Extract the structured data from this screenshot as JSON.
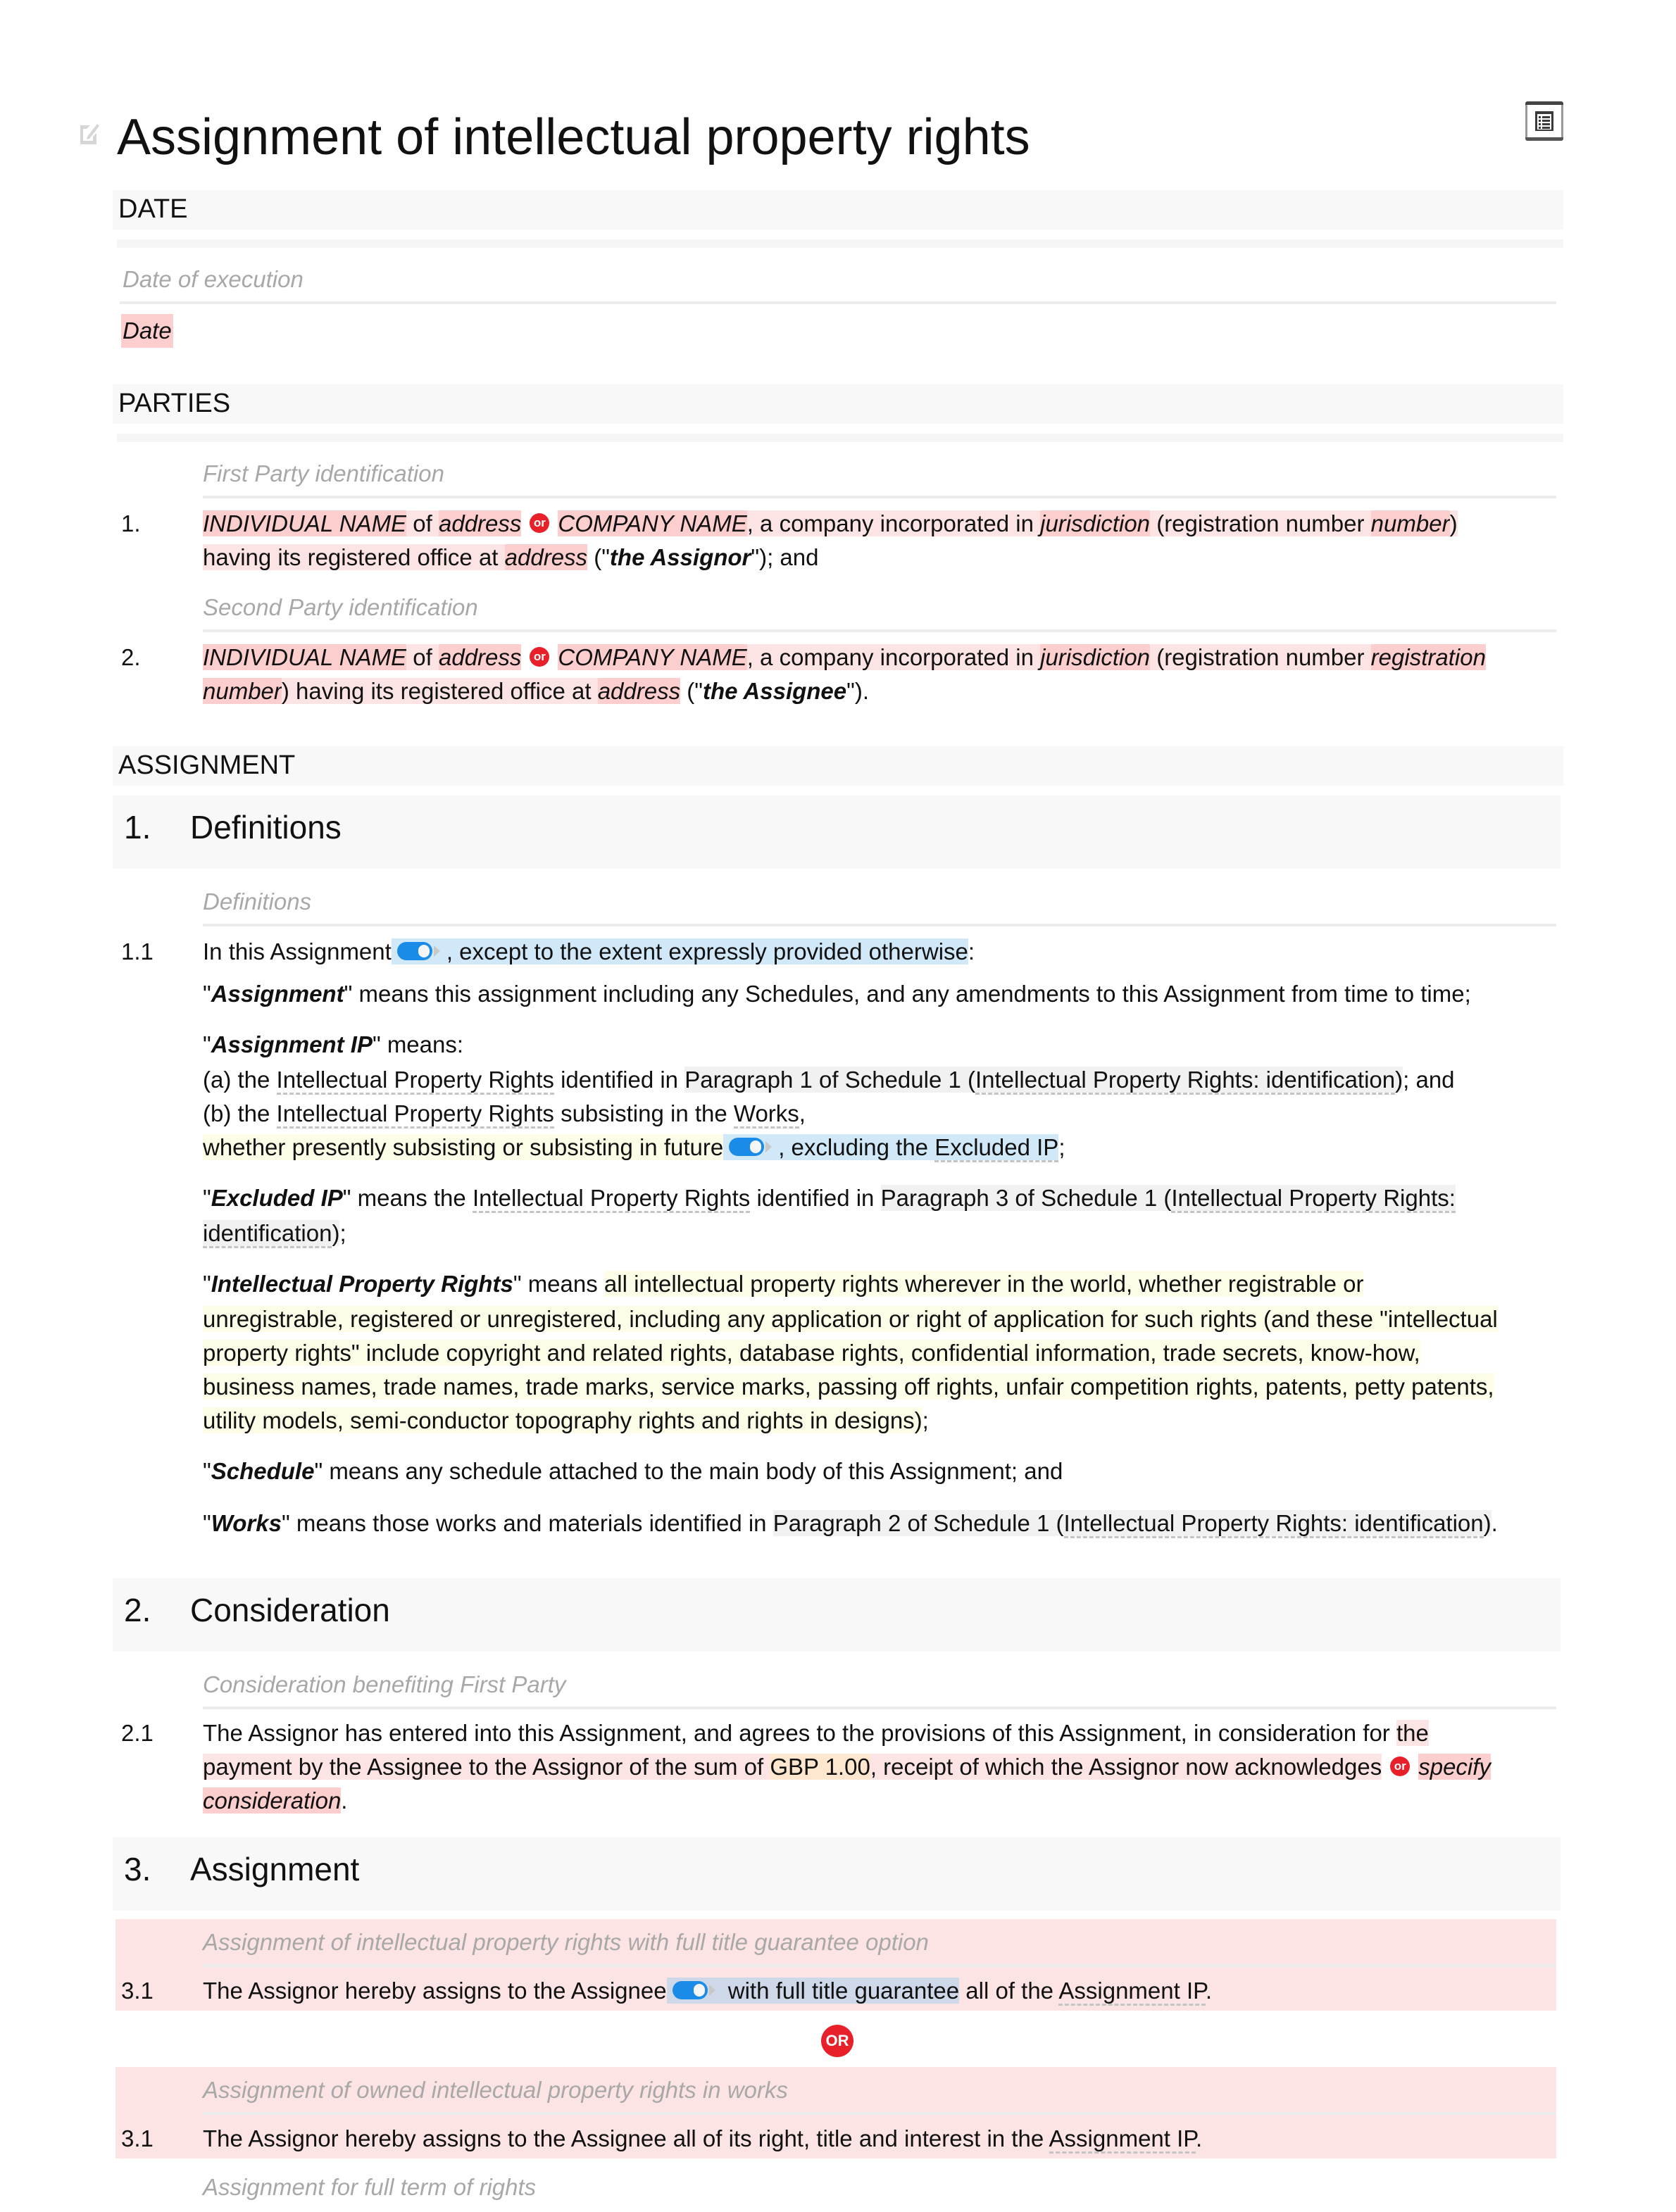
{
  "document": {
    "title": "Assignment of intellectual property rights",
    "icons": {
      "edit": "pencil-edit-icon",
      "toc": "table-of-contents-icon"
    }
  },
  "date_section": {
    "heading": "DATE",
    "hint": "Date of execution",
    "placeholder": "Date"
  },
  "parties_section": {
    "heading": "PARTIES",
    "parties": [
      {
        "hint": "First Party identification",
        "number": "1.",
        "individual_name": "INDIVIDUAL NAME",
        "of": " of ",
        "address": "address",
        "or_label": "or",
        "company_name": "COMPANY NAME",
        "incorporated": ", a company incorporated in ",
        "jurisdiction": "jurisdiction",
        "reg_prefix": " (registration number ",
        "reg_number_line1": "number",
        "reg_number_line2": "",
        "line1_end": ")",
        "line2_start": "having its registered office at ",
        "office_address": "address",
        "defined_open": " (\"",
        "defined_term": "the Assignor",
        "defined_close": "\"); and"
      },
      {
        "hint": "Second Party identification",
        "number": "2.",
        "individual_name": "INDIVIDUAL NAME",
        "of": " of ",
        "address": "address",
        "or_label": "or",
        "company_name": "COMPANY NAME",
        "incorporated": ", a company incorporated in ",
        "jurisdiction": "jurisdiction",
        "reg_prefix": " (registration number ",
        "reg_number_line1": "registration",
        "reg_number_line2": "number",
        "line1_end": "",
        "line2_start": ") having its registered office at ",
        "office_address": "address",
        "defined_open": " (\"",
        "defined_term": "the Assignee",
        "defined_close": "\")."
      }
    ]
  },
  "assignment_section": {
    "heading": "ASSIGNMENT"
  },
  "clause1": {
    "number": "1.",
    "title": "Definitions",
    "hint": "Definitions",
    "sub_number": "1.1",
    "intro_prefix": "In this Assignment",
    "intro_toggle_text": ", except to the extent expressly provided otherwise",
    "intro_suffix": ":",
    "defs": {
      "assignment": {
        "term": "Assignment",
        "text": "\" means this assignment including any Schedules, and any amendments to this Assignment from time to time;"
      },
      "assignment_ip": {
        "term": "Assignment IP",
        "text": "\" means:",
        "a_prefix": "(a)  the ",
        "a_link": "Intellectual Property Rights",
        "a_mid": " identified in ",
        "a_ref_pre": "Paragraph 1 of Schedule 1 (",
        "a_ref_link": "Intellectual Property Rights: identification",
        "a_ref_post": ")",
        "a_end": "; and",
        "b_prefix": "(b)  the ",
        "b_link": "Intellectual Property Rights",
        "b_mid": " subsisting in the ",
        "b_link2": "Works",
        "b_end": ",",
        "c_yellow": "whether presently subsisting or subsisting in future",
        "c_toggle_pre": ", excluding the ",
        "c_toggle_link": "Excluded IP",
        "c_end": ";"
      },
      "excluded_ip": {
        "term": "Excluded IP",
        "pre": "\" means the ",
        "link": "Intellectual Property Rights",
        "mid": " identified in ",
        "ref_pre": "Paragraph 3 of Schedule 1 (",
        "ref_link_line1": "Intellectual Property Rights:",
        "ref_link_line2": "identification",
        "ref_post": ")",
        "end": ";"
      },
      "ipr": {
        "term": "Intellectual Property Rights",
        "pre": "\" means ",
        "lines": [
          "all intellectual property rights wherever in the world, whether registrable or",
          "unregistrable, registered or unregistered, including any application or right of application for such rights (and these \"intellectual",
          "property rights\" include copyright and related rights, database rights, confidential information, trade secrets, know-how,",
          "business names, trade names, trade marks, service marks, passing off rights, unfair competition rights, patents, petty patents,",
          "utility models, semi-conductor topography rights and rights in designs)"
        ],
        "end": ";"
      },
      "schedule": {
        "term": "Schedule",
        "text": "\" means any schedule attached to the main body of this Assignment; and"
      },
      "works": {
        "term": "Works",
        "pre": "\" means those works and materials identified in ",
        "ref_pre": "Paragraph 2 of Schedule 1 (",
        "ref_link": "Intellectual Property Rights: identification",
        "ref_post": ")",
        "end": "."
      }
    }
  },
  "clause2": {
    "number": "2.",
    "title": "Consideration",
    "hint": "Consideration benefiting First Party",
    "sub_number": "2.1",
    "line1": "The Assignor has entered into this Assignment, and agrees to the provisions of this Assignment, in consideration for ",
    "line1_pink": "the",
    "line2_pre": "payment by the Assignee to the Assignor of the sum of ",
    "amount": "GBP 1.00",
    "line2_post": ", receipt of which the Assignor now acknowledges",
    "or_label": "or",
    "alt_line1": "specify",
    "alt_line2": "consideration",
    "end": "."
  },
  "clause3": {
    "number": "3.",
    "title": "Assignment",
    "options": [
      {
        "hint": "Assignment of intellectual property rights with full title guarantee option",
        "sub_number": "3.1",
        "pre": "The Assignor hereby assigns to the Assignee",
        "toggle_text": " with full title guarantee",
        "post": " all of the ",
        "link": "Assignment IP",
        "end": "."
      },
      {
        "hint": "Assignment of owned intellectual property rights in works",
        "sub_number": "3.1",
        "pre": "The Assignor hereby assigns to the Assignee all of its right, title and interest in the ",
        "link": "Assignment IP",
        "end": "."
      }
    ],
    "or_label": "OR",
    "next_hint": "Assignment for full term of rights"
  },
  "colors": {
    "placeholder_pink": "#fde4e4",
    "placeholder_dark_pink": "#fccece",
    "toggle_blue": "#1a8ce8",
    "toggle_highlight": "#d0e8f8",
    "yellow_highlight": "#fefde8",
    "or_red": "#e8202a",
    "amount_orange": "#ffe7cf",
    "section_band": "#f8f8f8",
    "hint_grey": "#a8a8a8"
  }
}
